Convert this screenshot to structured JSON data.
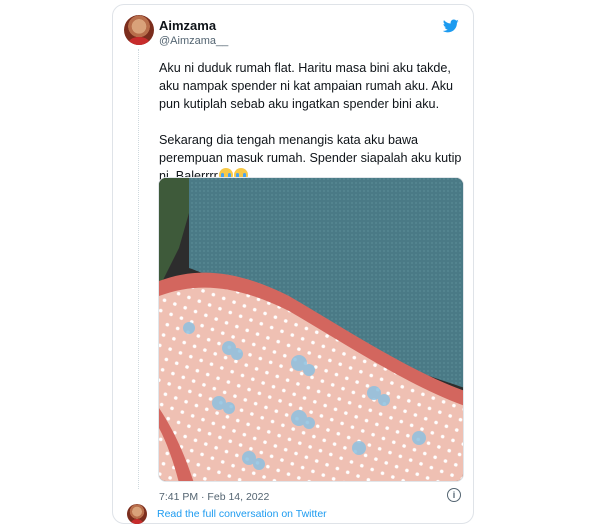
{
  "tweet": {
    "author_name": "Aimzama",
    "author_handle": "@Aimzama__",
    "paragraph1": "Aku ni duduk rumah flat. Haritu masa bini aku takde, aku nampak spender ni kat ampaian rumah aku. Aku pun kutiplah sebab aku ingatkan spender bini aku.",
    "paragraph2": "Sekarang dia tengah menangis kata aku bawa perempuan masuk rumah. Spender siapalah aku kutip ni. Balerrrr",
    "timestamp": "7:41 PM · Feb 14, 2022",
    "info_icon": "i"
  },
  "footer": {
    "read_link": "Read the full conversation on Twitter"
  },
  "icons": {
    "brand": "twitter-bird-icon",
    "emoji": "loudly-crying-face"
  },
  "colors": {
    "accent": "#1d9bf0",
    "text": "#0f1419",
    "muted": "#536471"
  }
}
